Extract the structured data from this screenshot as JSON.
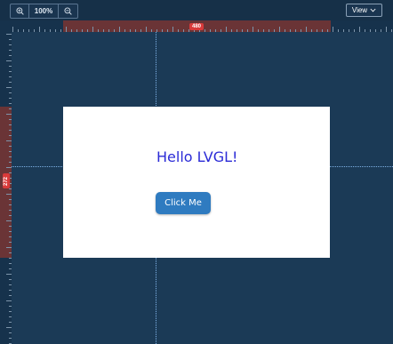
{
  "toolbar": {
    "zoom_in_icon": "zoom-in",
    "zoom_level": "100%",
    "zoom_out_icon": "zoom-out",
    "view_label": "View",
    "view_icon": "chevron-down"
  },
  "rulers": {
    "width_badge": "480",
    "height_badge": "272",
    "highlight_color": "#6a3436",
    "badge_color": "#d93a3a"
  },
  "screen": {
    "label_text": "Hello LVGL!",
    "label_color": "#2b2bd6",
    "button_text": "Click Me",
    "button_color": "#2f7bc0"
  },
  "colors": {
    "canvas_background": "#1b3a56",
    "guide": "#7fb2e6"
  }
}
